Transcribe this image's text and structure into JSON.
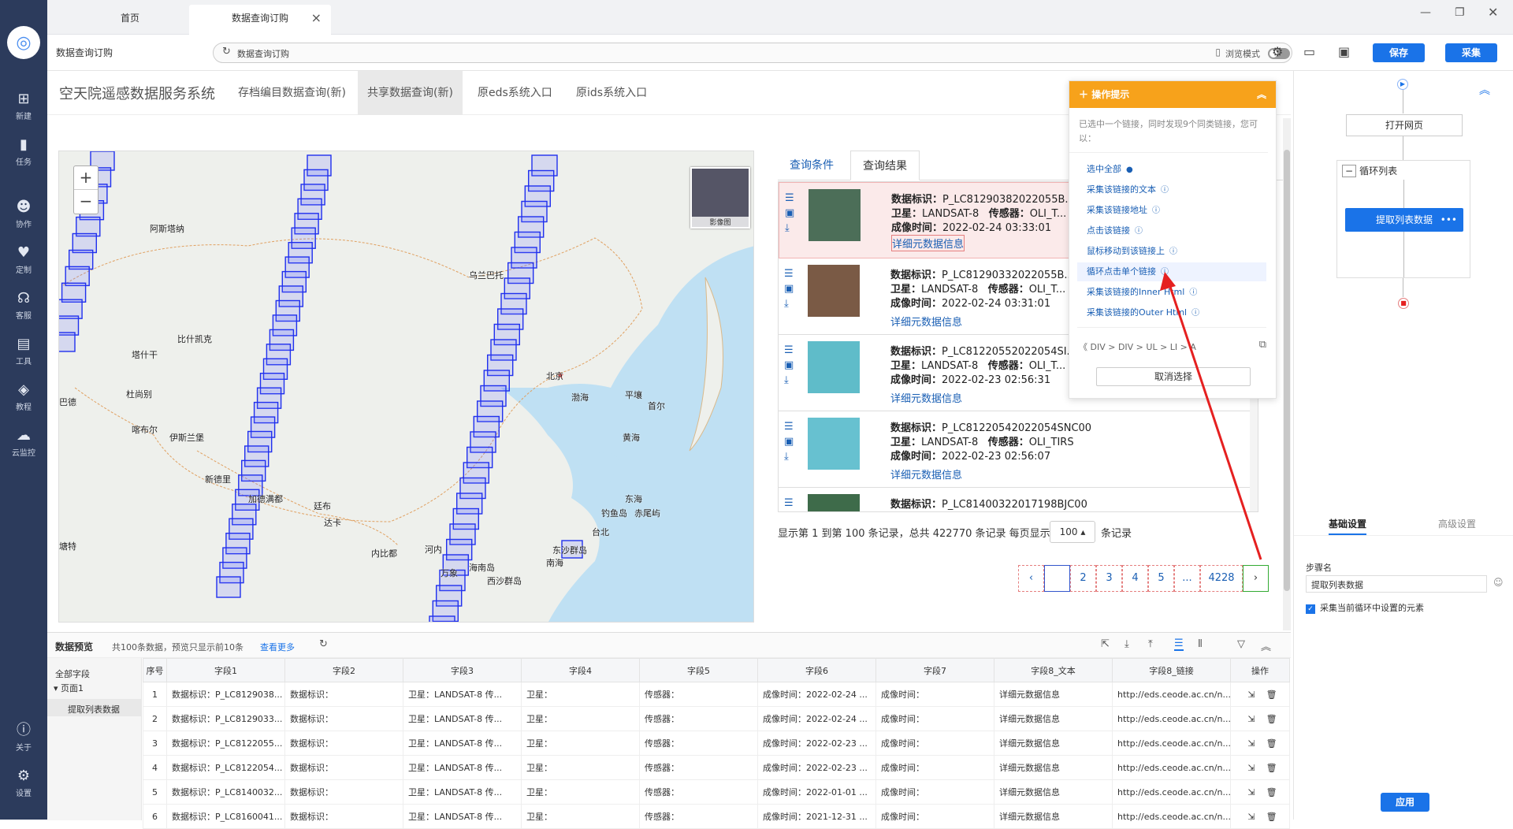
{
  "sidebar": {
    "items": [
      {
        "label": "新建",
        "icon": "plus-icon"
      },
      {
        "label": "任务",
        "icon": "bookmark-icon"
      },
      {
        "label": "协作",
        "icon": "users-icon"
      },
      {
        "label": "定制",
        "icon": "heart-icon"
      },
      {
        "label": "客服",
        "icon": "headset-icon"
      },
      {
        "label": "工具",
        "icon": "toolbox-icon"
      },
      {
        "label": "教程",
        "icon": "book-icon"
      },
      {
        "label": "云监控",
        "icon": "cloud-icon"
      },
      {
        "label": "关于",
        "icon": "info-icon"
      },
      {
        "label": "设置",
        "icon": "gear-icon"
      }
    ]
  },
  "tabs": {
    "home": "首页",
    "active": "数据查询订购"
  },
  "addressbar": {
    "page_title": "数据查询订购",
    "url": "数据查询订购",
    "browse_mode": "浏览模式",
    "save": "保存",
    "collect": "采集"
  },
  "site": {
    "title": "空天院遥感数据服务系统",
    "nav": [
      "存档编目数据查询(新)",
      "共享数据查询(新)",
      "原eds系统入口",
      "原ids系统入口"
    ]
  },
  "map": {
    "image_label": "影像图",
    "labels": [
      {
        "t": "阿斯塔纳"
      },
      {
        "t": "乌兰巴托"
      },
      {
        "t": "比什凯克"
      },
      {
        "t": "塔什干"
      },
      {
        "t": "杜尚别"
      },
      {
        "t": "巴德"
      },
      {
        "t": "喀布尔"
      },
      {
        "t": "伊斯兰堡"
      },
      {
        "t": "北京"
      },
      {
        "t": "渤海"
      },
      {
        "t": "平壤"
      },
      {
        "t": "首尔"
      },
      {
        "t": "黄海"
      },
      {
        "t": "新德里"
      },
      {
        "t": "加德满都"
      },
      {
        "t": "廷布"
      },
      {
        "t": "达卡"
      },
      {
        "t": "塘特"
      },
      {
        "t": "内比都"
      },
      {
        "t": "东海"
      },
      {
        "t": "钓鱼岛"
      },
      {
        "t": "赤尾屿"
      },
      {
        "t": "台北"
      },
      {
        "t": "南海"
      },
      {
        "t": "东沙群岛"
      },
      {
        "t": "西沙群岛"
      },
      {
        "t": "海南岛"
      },
      {
        "t": "河内"
      },
      {
        "t": "万象"
      }
    ]
  },
  "results": {
    "tabs": [
      "查询条件",
      "查询结果"
    ],
    "labels": {
      "id": "数据标识：",
      "sat": "卫星：",
      "sensor": "传感器：",
      "time": "成像时间：",
      "link": "详细元数据信息"
    },
    "items": [
      {
        "id": "P_LC81290382022055B...",
        "sat": "LANDSAT-8",
        "sensor": "OLI_T...",
        "time": "2022-02-24 03:33:01"
      },
      {
        "id": "P_LC81290332022055B...",
        "sat": "LANDSAT-8",
        "sensor": "OLI_T...",
        "time": "2022-02-24 03:31:01"
      },
      {
        "id": "P_LC81220552022054SI...",
        "sat": "LANDSAT-8",
        "sensor": "OLI_T...",
        "time": "2022-02-23 02:56:31"
      },
      {
        "id": "P_LC81220542022054SNC00",
        "sat": "LANDSAT-8",
        "sensor": "OLI_TIRS",
        "time": "2022-02-23 02:56:07"
      },
      {
        "id": "P_LC81400322017198BJC00",
        "sat": "",
        "sensor": "",
        "time": ""
      }
    ],
    "page_info": "显示第 1 到第 100 条记录，总共 422770 条记录 每页显示",
    "page_size": "100 ▴",
    "page_suffix": "条记录",
    "pages": [
      "‹",
      "",
      "2",
      "3",
      "4",
      "5",
      "...",
      "4228",
      "›"
    ]
  },
  "hint": {
    "title": "操作提示",
    "collapse": "︽",
    "desc": "已选中一个链接，同时发现9个同类链接，您可以：",
    "ops": [
      "选中全部",
      "采集该链接的文本",
      "采集该链接地址",
      "点击该链接",
      "鼠标移动到该链接上",
      "循环点击单个链接",
      "采集该链接的Inner Html",
      "采集该链接的Outer Html"
    ],
    "path": "《  DIV  >  DIV  >  UL  >  LI  >  A",
    "cancel": "取消选择"
  },
  "flow": {
    "open": "打开网页",
    "loop": "循环列表",
    "extract": "提取列表数据"
  },
  "settings": {
    "tabs": [
      "基础设置",
      "高级设置"
    ],
    "step_label": "步骤名",
    "step_value": "提取列表数据",
    "check_label": "采集当前循环中设置的元素",
    "apply": "应用"
  },
  "preview": {
    "title": "数据预览",
    "summary": "共100条数据，预览只显示前10条",
    "more": "查看更多",
    "tree": [
      "全部字段",
      "页面1",
      "提取列表数据"
    ],
    "columns": [
      "序号",
      "字段1",
      "字段2",
      "字段3",
      "字段4",
      "字段5",
      "字段6",
      "字段7",
      "字段8_文本",
      "字段8_链接",
      "操作"
    ],
    "rows": [
      [
        "1",
        "数据标识：P_LC8129038...",
        "数据标识：",
        "卫星：LANDSAT-8   传...",
        "卫星：",
        "传感器：",
        "成像时间：2022-02-24 ...",
        "成像时间：",
        "详细元数据信息",
        "http://eds.ceode.ac.cn/n..."
      ],
      [
        "2",
        "数据标识：P_LC8129033...",
        "数据标识：",
        "卫星：LANDSAT-8   传...",
        "卫星：",
        "传感器：",
        "成像时间：2022-02-24 ...",
        "成像时间：",
        "详细元数据信息",
        "http://eds.ceode.ac.cn/n..."
      ],
      [
        "3",
        "数据标识：P_LC8122055...",
        "数据标识：",
        "卫星：LANDSAT-8   传...",
        "卫星：",
        "传感器：",
        "成像时间：2022-02-23 ...",
        "成像时间：",
        "详细元数据信息",
        "http://eds.ceode.ac.cn/n..."
      ],
      [
        "4",
        "数据标识：P_LC8122054...",
        "数据标识：",
        "卫星：LANDSAT-8   传...",
        "卫星：",
        "传感器：",
        "成像时间：2022-02-23 ...",
        "成像时间：",
        "详细元数据信息",
        "http://eds.ceode.ac.cn/n..."
      ],
      [
        "5",
        "数据标识：P_LC8140032...",
        "数据标识：",
        "卫星：LANDSAT-8   传...",
        "卫星：",
        "传感器：",
        "成像时间：2022-01-01 ...",
        "成像时间：",
        "详细元数据信息",
        "http://eds.ceode.ac.cn/n..."
      ],
      [
        "6",
        "数据标识：P_LC8160041...",
        "数据标识：",
        "卫星：LANDSAT-8   传...",
        "卫星：",
        "传感器：",
        "成像时间：2021-12-31 ...",
        "成像时间：",
        "详细元数据信息",
        "http://eds.ceode.ac.cn/n..."
      ]
    ]
  }
}
